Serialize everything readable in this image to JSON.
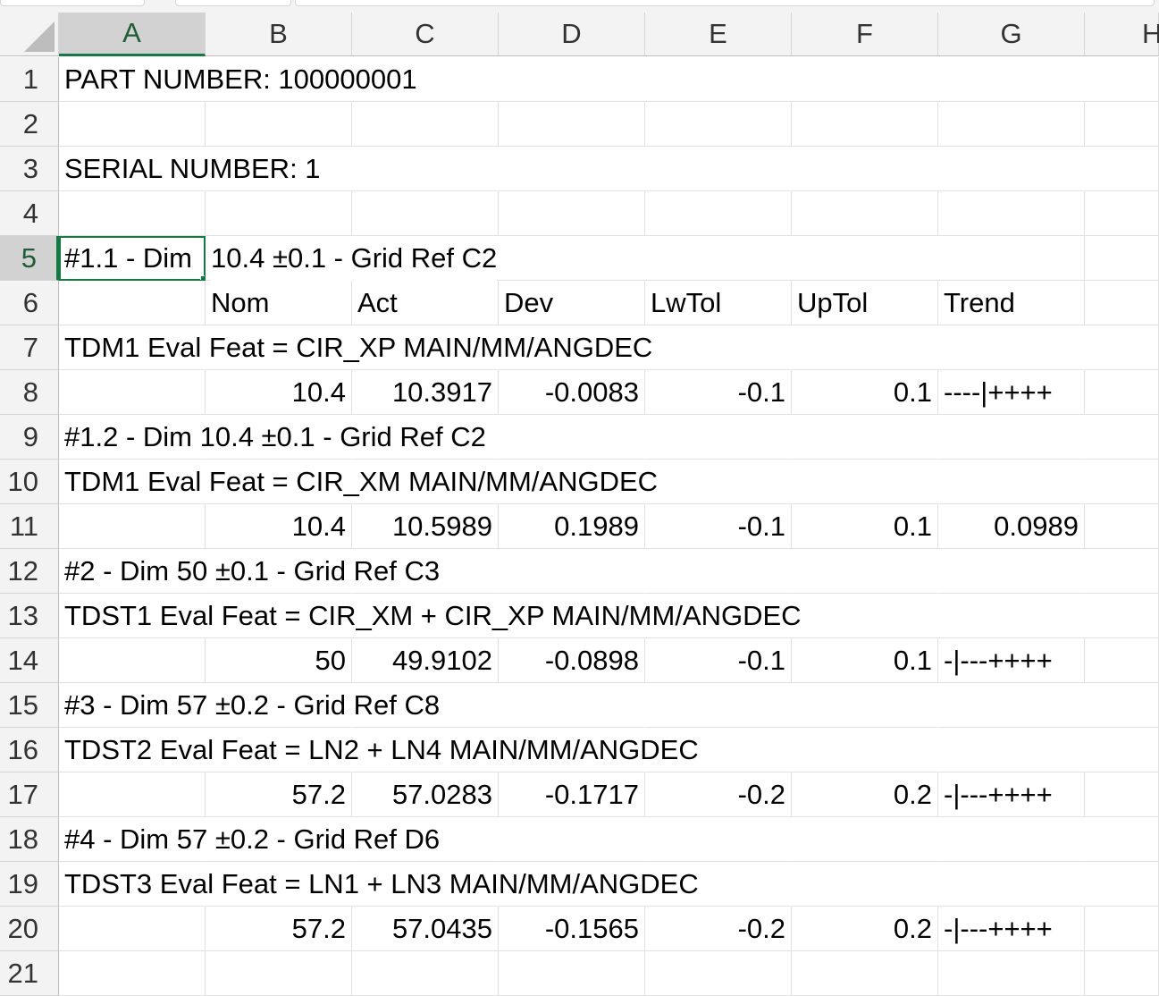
{
  "columns": [
    "A",
    "B",
    "C",
    "D",
    "E",
    "F",
    "G",
    "H"
  ],
  "selection": {
    "column": "A",
    "row": 5
  },
  "colors": {
    "selected_accent": "#107c41",
    "header_bg": "#f3f3f3",
    "gridline": "#e1e1e1"
  },
  "rows": [
    {
      "num": "1",
      "a": "PART NUMBER: 100000001"
    },
    {
      "num": "2"
    },
    {
      "num": "3",
      "a": "SERIAL NUMBER: 1"
    },
    {
      "num": "4"
    },
    {
      "num": "5",
      "a": "#1.1 - Dim 10.4 ±0.1 - Grid Ref C2",
      "a_visible": "#1.1 - Dim",
      "b_overflow": "10.4 ±0.1 - Grid Ref C2"
    },
    {
      "num": "6",
      "b": "Nom",
      "c": "Act",
      "d": "Dev",
      "e": "LwTol",
      "f": "UpTol",
      "g": "Trend"
    },
    {
      "num": "7",
      "a": "TDM1  Eval Feat =  CIR_XP   MAIN/MM/ANGDEC"
    },
    {
      "num": "8",
      "b": "10.4",
      "c": "10.3917",
      "d": "-0.0083",
      "e": "-0.1",
      "f": "0.1",
      "g": "----|++++"
    },
    {
      "num": "9",
      "a": "#1.2 - Dim 10.4 ±0.1 - Grid Ref C2"
    },
    {
      "num": "10",
      "a": "TDM1  Eval Feat =  CIR_XM   MAIN/MM/ANGDEC"
    },
    {
      "num": "11",
      "b": "10.4",
      "c": "10.5989",
      "d": "0.1989",
      "e": "-0.1",
      "f": "0.1",
      "g": "0.0989"
    },
    {
      "num": "12",
      "a": "#2 - Dim 50 ±0.1 - Grid Ref C3"
    },
    {
      "num": "13",
      "a": "TDST1  Eval Feat =  CIR_XM + CIR_XP   MAIN/MM/ANGDEC"
    },
    {
      "num": "14",
      "b": "50",
      "c": "49.9102",
      "d": "-0.0898",
      "e": "-0.1",
      "f": "0.1",
      "g": "-|---++++"
    },
    {
      "num": "15",
      "a": "#3 - Dim 57 ±0.2 - Grid Ref C8"
    },
    {
      "num": "16",
      "a": "TDST2  Eval Feat =  LN2 + LN4   MAIN/MM/ANGDEC"
    },
    {
      "num": "17",
      "b": "57.2",
      "c": "57.0283",
      "d": "-0.1717",
      "e": "-0.2",
      "f": "0.2",
      "g": "-|---++++"
    },
    {
      "num": "18",
      "a": "#4 - Dim 57 ±0.2 - Grid Ref D6"
    },
    {
      "num": "19",
      "a": "TDST3  Eval Feat =  LN1 + LN3   MAIN/MM/ANGDEC"
    },
    {
      "num": "20",
      "b": "57.2",
      "c": "57.0435",
      "d": "-0.1565",
      "e": "-0.2",
      "f": "0.2",
      "g": "-|---++++"
    },
    {
      "num": "21"
    }
  ]
}
